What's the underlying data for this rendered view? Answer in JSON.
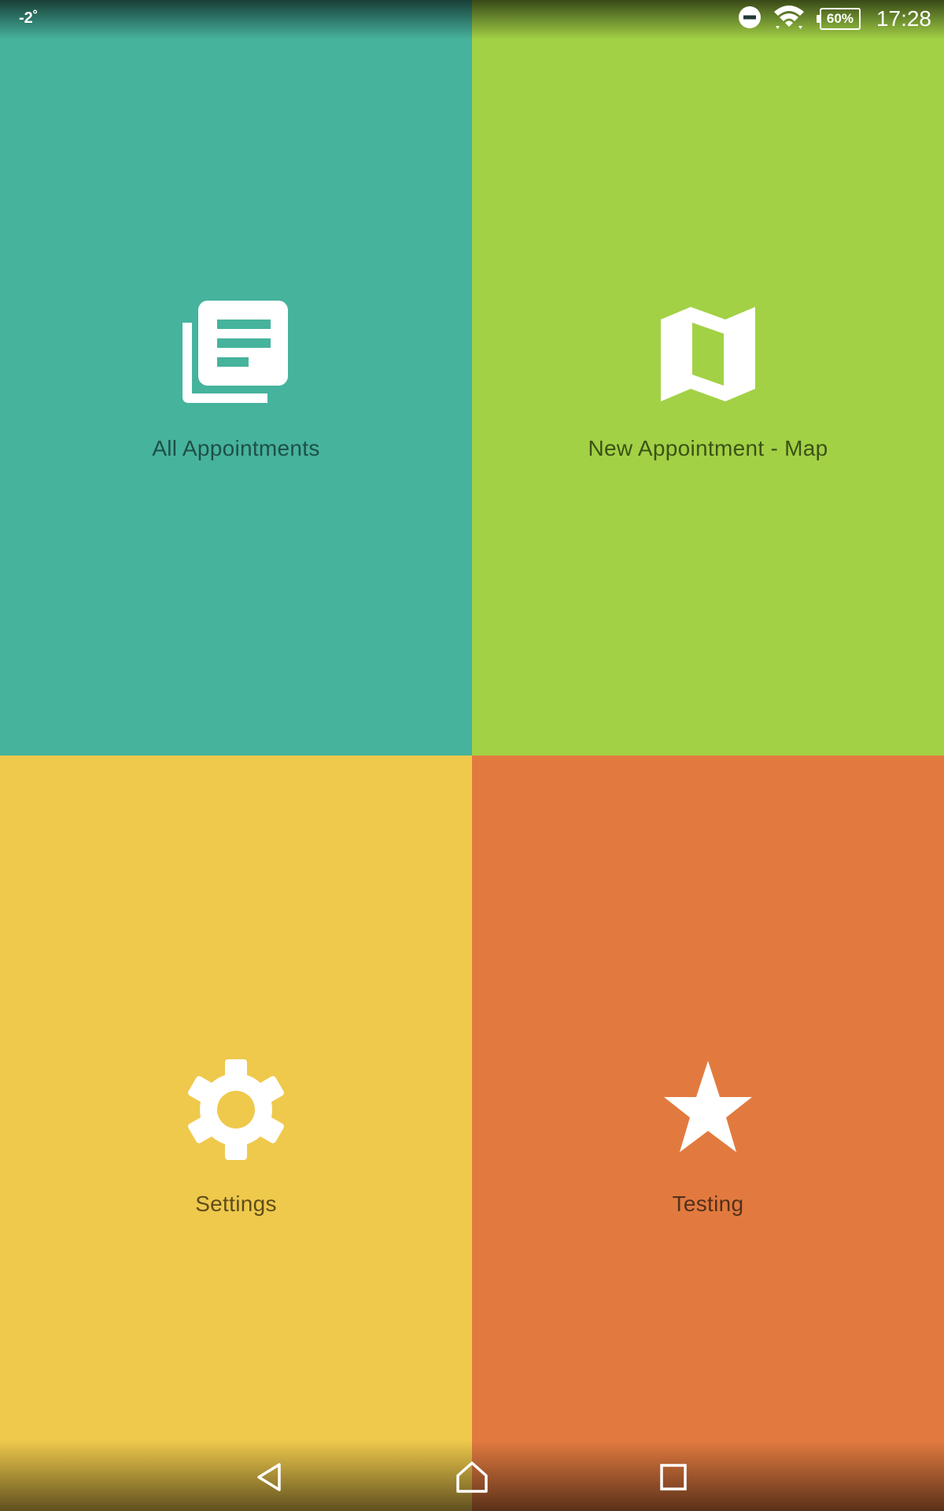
{
  "status_bar": {
    "left_text": "-2˚",
    "battery_percent": "60%",
    "time": "17:28",
    "icons": [
      "do-not-disturb-icon",
      "wifi-icon",
      "battery-icon"
    ]
  },
  "tiles": [
    {
      "label": "All Appointments",
      "icon": "news-list-icon",
      "bg_color": "#46b39d",
      "text_color": "#1f4f45"
    },
    {
      "label": "New Appointment - Map",
      "icon": "map-icon",
      "bg_color": "#a2d145",
      "text_color": "#3b5215"
    },
    {
      "label": "Settings",
      "icon": "gear-icon",
      "bg_color": "#efc94c",
      "text_color": "#5e4d1a"
    },
    {
      "label": "Testing",
      "icon": "star-icon",
      "bg_color": "#e27a3f",
      "text_color": "#53301a"
    }
  ],
  "nav_bar": {
    "buttons": [
      "back-icon",
      "home-icon",
      "recents-icon"
    ]
  }
}
